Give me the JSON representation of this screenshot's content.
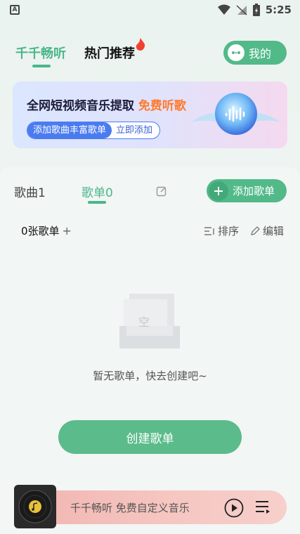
{
  "status": {
    "time": "5:25",
    "app_icon_letter": "A"
  },
  "tabs": [
    {
      "label": "千千畅听",
      "active": true
    },
    {
      "label": "热门推荐",
      "active": false
    }
  ],
  "mine_button": {
    "label": "我的"
  },
  "banner": {
    "title": "全网短视频音乐提取",
    "highlight": "免费听歌",
    "pill_left": "添加歌曲丰富歌单",
    "pill_right": "立即添加"
  },
  "content_tabs": {
    "songs": "歌曲1",
    "playlists": "歌单0"
  },
  "add_playlist_button": "添加歌单",
  "list_header": {
    "count": "0张歌单",
    "plus": "+",
    "sort": "排序",
    "edit": "编辑"
  },
  "empty": {
    "glyph": "空",
    "text": "暂无歌单，快去创建吧~"
  },
  "create_button": "创建歌单",
  "player": {
    "text": "千千畅听 免费自定义音乐"
  },
  "colors": {
    "accent": "#52b989",
    "highlight": "#ff7a2e",
    "banner_blue": "#4a7cf0"
  }
}
